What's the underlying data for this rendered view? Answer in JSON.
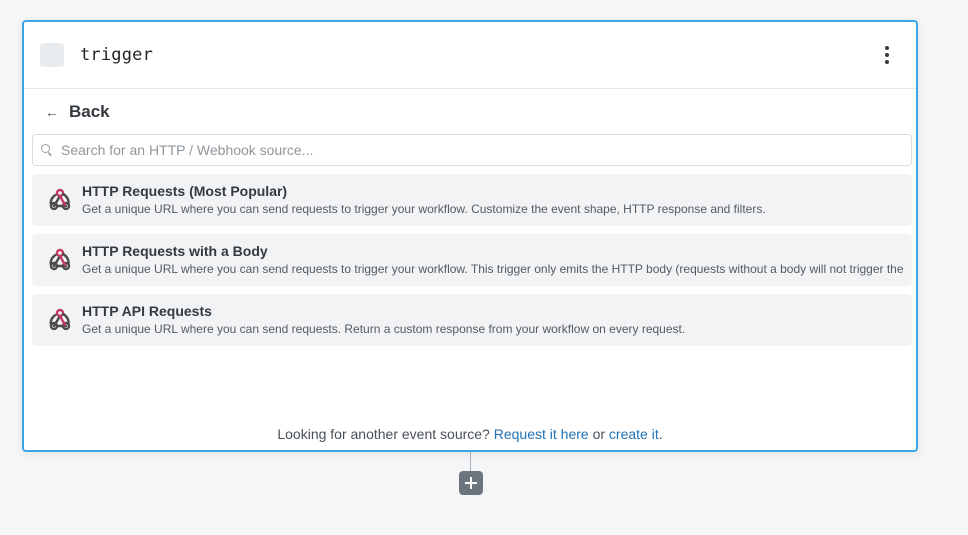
{
  "step": {
    "name": "trigger"
  },
  "nav": {
    "back_label": "Back",
    "back_arrow": "←"
  },
  "search": {
    "placeholder": "Search for an HTTP / Webhook source..."
  },
  "sources": [
    {
      "title": "HTTP Requests (Most Popular)",
      "description": "Get a unique URL where you can send requests to trigger your workflow. Customize the event shape, HTTP response and filters.",
      "icon": "webhook-icon"
    },
    {
      "title": "HTTP Requests with a Body",
      "description": "Get a unique URL where you can send requests to trigger your workflow. This trigger only emits the HTTP body (requests without a body will not trigger the",
      "icon": "webhook-icon"
    },
    {
      "title": "HTTP API Requests",
      "description": "Get a unique URL where you can send requests. Return a custom response from your workflow on every request.",
      "icon": "webhook-icon"
    }
  ],
  "footer": {
    "prefix": "Looking for another event source? ",
    "request_link": "Request it here",
    "middle": " or ",
    "create_link": "create it",
    "suffix": "."
  },
  "colors": {
    "accent_border": "#3ba6e4",
    "link": "#2272b4",
    "webhook_red": "#c73a63"
  }
}
